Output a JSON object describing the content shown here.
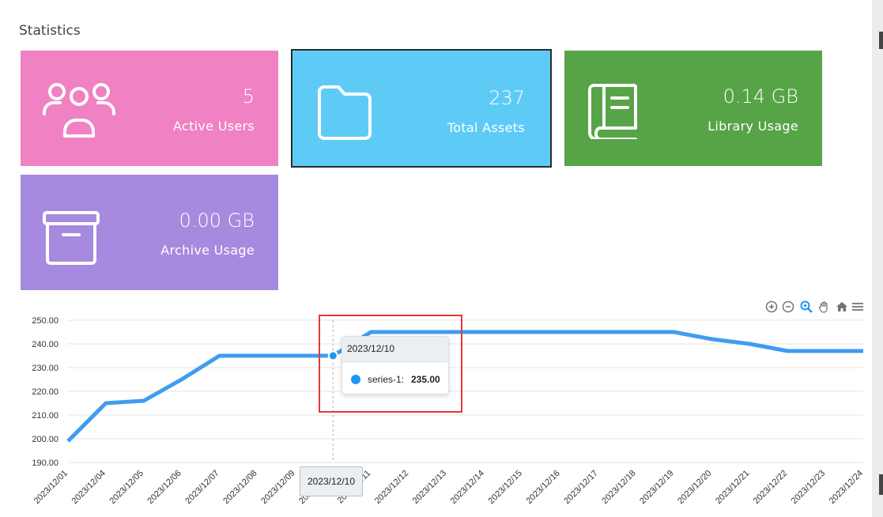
{
  "section": {
    "title": "Statistics"
  },
  "cards": {
    "active_users": {
      "value": "5",
      "label": "Active Users",
      "color": "#f081c2",
      "icon": "users-icon"
    },
    "total_assets": {
      "value": "237",
      "label": "Total Assets",
      "color": "#5ecbf7",
      "icon": "folder-icon"
    },
    "library_usage": {
      "value": "0.14 GB",
      "label": "Library Usage",
      "color": "#56a447",
      "icon": "book-icon"
    },
    "archive_usage": {
      "value": "0.00 GB",
      "label": "Archive Usage",
      "color": "#a68ae0",
      "icon": "archive-box-icon"
    }
  },
  "toolbar": {
    "icons": [
      "zoom-in-icon",
      "zoom-out-icon",
      "zoom-selection-icon",
      "pan-hand-icon",
      "reset-home-icon",
      "menu-icon"
    ]
  },
  "chart_data": {
    "type": "line",
    "x": [
      "2023/12/01",
      "2023/12/04",
      "2023/12/05",
      "2023/12/06",
      "2023/12/07",
      "2023/12/08",
      "2023/12/09",
      "2023/12/10",
      "2023/12/11",
      "2023/12/12",
      "2023/12/13",
      "2023/12/14",
      "2023/12/15",
      "2023/12/16",
      "2023/12/17",
      "2023/12/18",
      "2023/12/19",
      "2023/12/20",
      "2023/12/21",
      "2023/12/22",
      "2023/12/23",
      "2023/12/24"
    ],
    "series": [
      {
        "name": "series-1",
        "color": "#409cf0",
        "values": [
          199,
          215,
          216,
          225,
          235,
          235,
          235,
          235,
          245,
          245,
          245,
          245,
          245,
          245,
          245,
          245,
          245,
          242,
          240,
          237,
          237,
          237
        ]
      }
    ],
    "yticks": [
      "250.00",
      "240.00",
      "230.00",
      "220.00",
      "210.00",
      "200.00",
      "190.00"
    ],
    "ylim": [
      190,
      250
    ],
    "grid": true,
    "tooltip": {
      "date": "2023/12/10",
      "series_label": "series-1:",
      "value": "235.00"
    },
    "xaxis_tooltip": "2023/12/10"
  }
}
